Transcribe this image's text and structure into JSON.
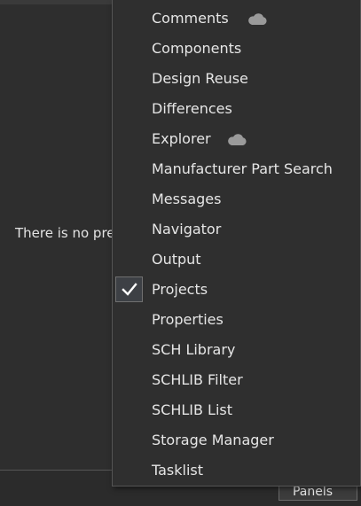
{
  "background": {
    "message": "There is no pre",
    "panels_button_label": "Panels"
  },
  "menu": {
    "items": [
      {
        "label": "Comments",
        "cloud": true
      },
      {
        "label": "Components"
      },
      {
        "label": "Design Reuse"
      },
      {
        "label": "Differences"
      },
      {
        "label": "Explorer",
        "cloud": true
      },
      {
        "label": "Manufacturer Part Search"
      },
      {
        "label": "Messages"
      },
      {
        "label": "Navigator"
      },
      {
        "label": "Output"
      },
      {
        "label": "Projects",
        "checked": true
      },
      {
        "label": "Properties"
      },
      {
        "label": "SCH Library"
      },
      {
        "label": "SCHLIB Filter"
      },
      {
        "label": "SCHLIB List"
      },
      {
        "label": "Storage Manager"
      },
      {
        "label": "Tasklist"
      }
    ]
  },
  "colors": {
    "menu_bg": "#2f2f2f",
    "menu_border": "#555555",
    "text": "#e6e6e6",
    "cloud": "#9a9a9a",
    "check": "#ffffff"
  }
}
